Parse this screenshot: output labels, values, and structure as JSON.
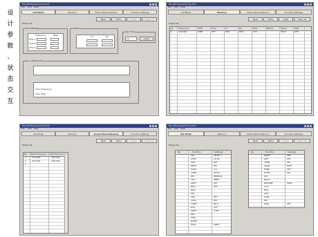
{
  "caption_chars": [
    "设",
    "计",
    "参",
    "数",
    "、",
    "状",
    "态",
    "交",
    "互"
  ],
  "window": {
    "title": "MC-400 Programming Tool",
    "menu": [
      "File",
      "Edit",
      "Help"
    ],
    "tabs": [
      "Set Mode",
      "Memory",
      "Search Band Memory",
      "Function Settings"
    ],
    "buttons": [
      "Read",
      "Write",
      "Clear",
      "Clear All"
    ],
    "section_mode": "Mode1 ID:"
  },
  "panes": {
    "a": {
      "group_vfo": "VFO Settings",
      "vfo_headers": [
        "Frequency",
        "Step"
      ],
      "vfo_rows": [
        "VFO A",
        "VFO B",
        "VFO C"
      ],
      "group_ctcss": "CTCSS",
      "ctcss_headers": [
        "Tx",
        "Rx"
      ],
      "group_delay": "Scan Time",
      "delay_value": "10",
      "delay_btn": "Apply",
      "group_scan": "Scan setting VFO",
      "scan_rows_a": [
        "",
        "",
        "",
        "",
        ""
      ],
      "scan_label_b": "Scan Frequency",
      "scan_label_c": "Scan Step"
    },
    "b": {
      "headers": [
        "Ch",
        "Frequency",
        "Shift",
        "Tone",
        "Tx",
        "Rx",
        "DCS",
        "Name",
        "Power",
        "Skip"
      ],
      "first_row": [
        "1",
        "144.000",
        "SIMP",
        "OFF",
        "88.5",
        "88.5",
        "023",
        "",
        "HIGH",
        "OFF"
      ]
    },
    "c": {
      "headers": [
        "No.",
        "Start Frequency",
        "Stop Frequency"
      ],
      "rows": [
        [
          "1",
          "144.000",
          "146.000"
        ],
        [
          "2",
          "430.000",
          "440.000"
        ],
        [
          "3",
          "",
          ""
        ]
      ]
    },
    "d": {
      "headers": [
        "No.",
        "Function",
        "Settings"
      ],
      "left_functions": [
        "SQL",
        "STEP",
        "APO",
        "BEEP",
        "SAVE",
        "LAMP",
        "KEY",
        "TOT",
        "ARTS",
        "BELL",
        "DIAL",
        "MIC",
        "VOX",
        "LOCK",
        "TONE",
        "DCS",
        "SHIFT",
        "RPT",
        "SKIP",
        "NAME",
        "DISP"
      ],
      "left_values": [
        "LEVEL 1",
        "12.5K",
        "OFF",
        "ON",
        "1:2",
        "AUTO",
        "MANUAL",
        "3MIN",
        "OFF",
        "OFF",
        "",
        "",
        "OFF",
        "KEY",
        "88.5",
        "023",
        "0.6M",
        "",
        "",
        "",
        "FREQ"
      ],
      "right_functions": [
        "BAND",
        "ANT",
        "TONE",
        "SCAN",
        "MONI",
        "DTMF",
        "WX",
        "BCLO",
        "RESUME",
        "LCD",
        "EDG",
        "APO",
        "SCNL",
        "PRI",
        "DWS"
      ],
      "right_values": [
        "VHF",
        "EXT",
        "ON",
        "BUSY",
        "OFF",
        "ON",
        "",
        "",
        "5SEC",
        "",
        "",
        "",
        "",
        "",
        "OFF"
      ]
    }
  }
}
